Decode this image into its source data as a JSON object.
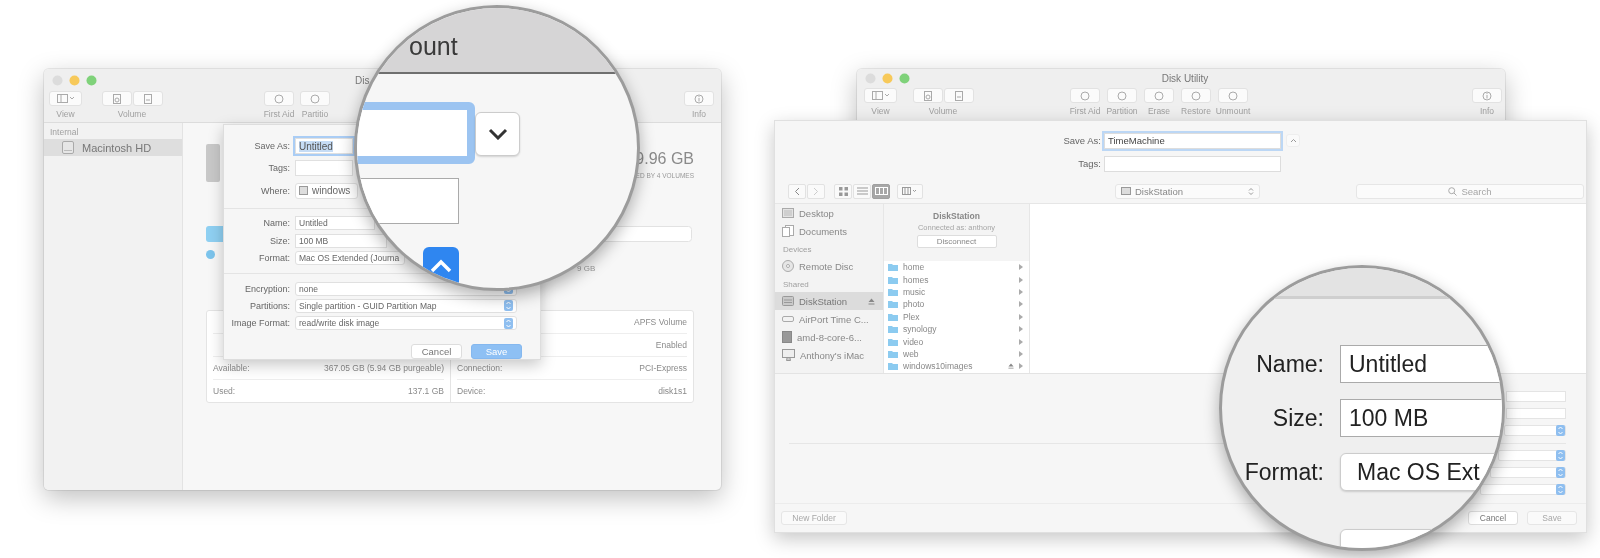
{
  "left_window": {
    "title": "Dis",
    "toolbar": [
      {
        "label": "View",
        "kind": "view"
      },
      {
        "label": "Volume",
        "kind": "pair"
      },
      {
        "label": "First Aid",
        "kind": "action"
      },
      {
        "label": "Partitio",
        "kind": "action"
      },
      {
        "label": "Info",
        "kind": "info"
      }
    ],
    "sidebar": {
      "heading": "Internal",
      "items": [
        {
          "label": "Macintosh HD",
          "selected": true
        }
      ]
    },
    "disk": {
      "capacity": "9.96 GB",
      "shared": "ED BY 4 VOLUMES",
      "legend_size": "9 GB"
    },
    "info_left": [
      {
        "label": "Available:",
        "value": "367.05 GB (5.94 GB purgeable)"
      },
      {
        "label": "Used:",
        "value": "137.1 GB"
      }
    ],
    "info_right": [
      {
        "value": "APFS Volume"
      },
      {
        "value": "Enabled"
      },
      {
        "label": "Connection:",
        "value": "PCI-Express"
      },
      {
        "label": "Device:",
        "value": "disk1s1"
      }
    ],
    "sheet": {
      "save_as": {
        "label": "Save As:",
        "value": "Untitled"
      },
      "tags": {
        "label": "Tags:"
      },
      "where": {
        "label": "Where:",
        "value": "windows"
      },
      "fields": [
        {
          "label": "Name:",
          "value": "Untitled",
          "kind": "text"
        },
        {
          "label": "Size:",
          "value": "100 MB",
          "kind": "text"
        },
        {
          "label": "Format:",
          "value": "Mac OS Extended (Journa",
          "kind": "popup"
        }
      ],
      "options": [
        {
          "label": "Encryption:",
          "value": "none"
        },
        {
          "label": "Partitions:",
          "value": "Single partition - GUID Partition Map"
        },
        {
          "label": "Image Format:",
          "value": "read/write disk image"
        }
      ],
      "buttons": [
        {
          "label": "Cancel",
          "kind": "cancel",
          "disabled": false
        },
        {
          "label": "Save",
          "kind": "default",
          "disabled": false
        }
      ]
    }
  },
  "magnifier_left": {
    "title_fragment": "ount"
  },
  "right_window": {
    "title": "Disk Utility",
    "toolbar": [
      {
        "label": "View",
        "kind": "view"
      },
      {
        "label": "Volume",
        "kind": "pair"
      },
      {
        "label": "First Aid",
        "kind": "action"
      },
      {
        "label": "Partition",
        "kind": "action"
      },
      {
        "label": "Erase",
        "kind": "action"
      },
      {
        "label": "Restore",
        "kind": "action"
      },
      {
        "label": "Unmount",
        "kind": "action"
      },
      {
        "label": "Info",
        "kind": "info"
      }
    ],
    "sheet": {
      "save_as": {
        "label": "Save As:",
        "value": "TimeMachine"
      },
      "tags": {
        "label": "Tags:"
      },
      "views": [
        {
          "kind": "icons",
          "selected": false
        },
        {
          "kind": "list",
          "selected": false
        },
        {
          "kind": "columns",
          "selected": true
        }
      ],
      "location": "DiskStation",
      "search": {
        "placeholder": "Search"
      },
      "sidebar": [
        {
          "items": [
            {
              "label": "Desktop",
              "kind": "desktop",
              "selected": false,
              "ejectable": false
            },
            {
              "label": "Documents",
              "kind": "documents",
              "selected": false,
              "ejectable": false
            }
          ]
        },
        {
          "heading": "Devices",
          "items": [
            {
              "label": "Remote Disc",
              "kind": "disc",
              "selected": false,
              "ejectable": false
            }
          ]
        },
        {
          "heading": "Shared",
          "items": [
            {
              "label": "DiskStation",
              "kind": "server",
              "selected": true,
              "ejectable": true
            },
            {
              "label": "AirPort Time C...",
              "kind": "router",
              "selected": false,
              "ejectable": false
            },
            {
              "label": "amd-8-core-6...",
              "kind": "tower",
              "selected": false,
              "ejectable": false
            },
            {
              "label": "Anthony's iMac",
              "kind": "monitor",
              "selected": false,
              "ejectable": false
            }
          ]
        }
      ],
      "server": {
        "name": "DiskStation",
        "connected": "Connected as: anthony",
        "disconnect": "Disconnect"
      },
      "folders": [
        {
          "name": "home",
          "ejectable": false
        },
        {
          "name": "homes",
          "ejectable": false
        },
        {
          "name": "music",
          "ejectable": false
        },
        {
          "name": "photo",
          "ejectable": false
        },
        {
          "name": "Plex",
          "ejectable": false
        },
        {
          "name": "synology",
          "ejectable": false
        },
        {
          "name": "video",
          "ejectable": false
        },
        {
          "name": "web",
          "ejectable": false
        },
        {
          "name": "windows10images",
          "ejectable": true
        }
      ],
      "buttons": [
        {
          "label": "New Folder",
          "kind": "secondary",
          "disabled": true
        },
        {
          "label": "Cancel",
          "kind": "cancel",
          "disabled": false
        },
        {
          "label": "Save",
          "kind": "default",
          "disabled": true
        }
      ]
    }
  },
  "magnifier_right": {
    "fields": [
      {
        "label": "Name:",
        "value": "Untitled",
        "kind": "text"
      },
      {
        "label": "Size:",
        "value": "100 MB",
        "kind": "text"
      },
      {
        "label": "Format:",
        "value": "Mac OS Ext",
        "kind": "popup"
      }
    ]
  }
}
